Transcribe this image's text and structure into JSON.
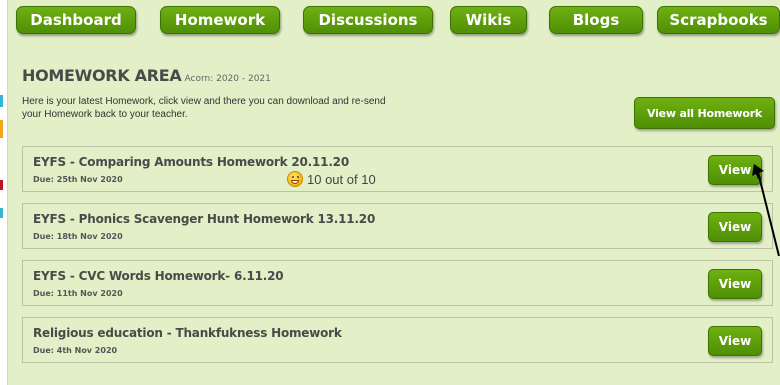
{
  "nav": {
    "tabs": [
      {
        "label": "Dashboard"
      },
      {
        "label": "Homework"
      },
      {
        "label": "Discussions"
      },
      {
        "label": "Wikis"
      },
      {
        "label": "Blogs"
      },
      {
        "label": "Scrapbooks"
      }
    ]
  },
  "homework_area": {
    "title": "HOMEWORK AREA",
    "subtitle": "Acorn: 2020 - 2021",
    "intro": "Here is your latest Homework, click view and there you can download and re-send your Homework back to your teacher.",
    "view_all_label": "View all Homework"
  },
  "items": [
    {
      "title": "EYFS - Comparing Amounts Homework 20.11.20",
      "due": "Due: 25th Nov 2020",
      "grade": "10 out of 10",
      "grade_icon": "smiley-icon",
      "view_label": "View"
    },
    {
      "title": "EYFS - Phonics Scavenger Hunt Homework 13.11.20",
      "due": "Due: 18th Nov 2020",
      "view_label": "View"
    },
    {
      "title": "EYFS - CVC Words Homework- 6.11.20",
      "due": "Due: 11th Nov 2020",
      "view_label": "View"
    },
    {
      "title": "Religious education - Thankfukness Homework",
      "due": "Due: 4th Nov 2020",
      "view_label": "View"
    }
  ],
  "colors": {
    "accent": "#5a9e0a",
    "panel_bg": "#e2efc7",
    "row_border": "#b9c4a6"
  }
}
